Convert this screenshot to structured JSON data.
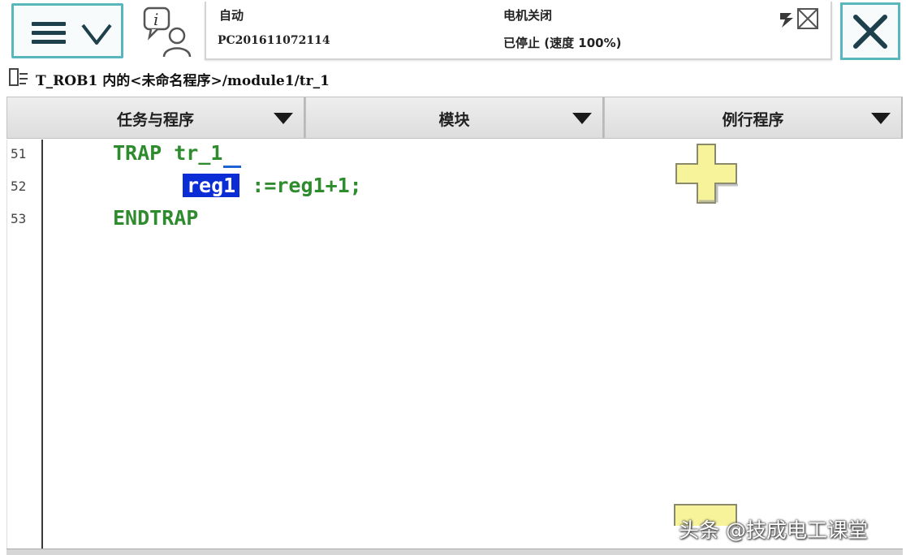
{
  "header": {
    "mode": "自动",
    "controller": "PC201611072114",
    "motor_state": "电机关闭",
    "run_state": "已停止 (速度 100%)"
  },
  "path": {
    "text": "T_ROB1 内的<未命名程序>/module1/tr_1"
  },
  "tabs": [
    {
      "label": "任务与程序"
    },
    {
      "label": "模块"
    },
    {
      "label": "例行程序"
    }
  ],
  "editor": {
    "lines": [
      {
        "number": "51",
        "code": "TRAP tr_1"
      },
      {
        "number": "52",
        "selected": "reg1",
        "rest": " :=reg1+1;"
      },
      {
        "number": "53",
        "code": "ENDTRAP"
      }
    ]
  },
  "watermark": "头条 @技成电工课堂",
  "icons": {
    "menu": "hamburger-menu-icon",
    "dropdown": "chevron-down-icon",
    "info": "event-log-info-icon",
    "status": "robot-status-icon",
    "close": "close-icon",
    "path": "program-path-icon",
    "plus": "plus-icon"
  },
  "colors": {
    "accent_border": "#58b7bd",
    "code_green": "#2e8b2e",
    "selection_blue": "#0b2dd6",
    "plus_yellow": "#f7f39a"
  }
}
